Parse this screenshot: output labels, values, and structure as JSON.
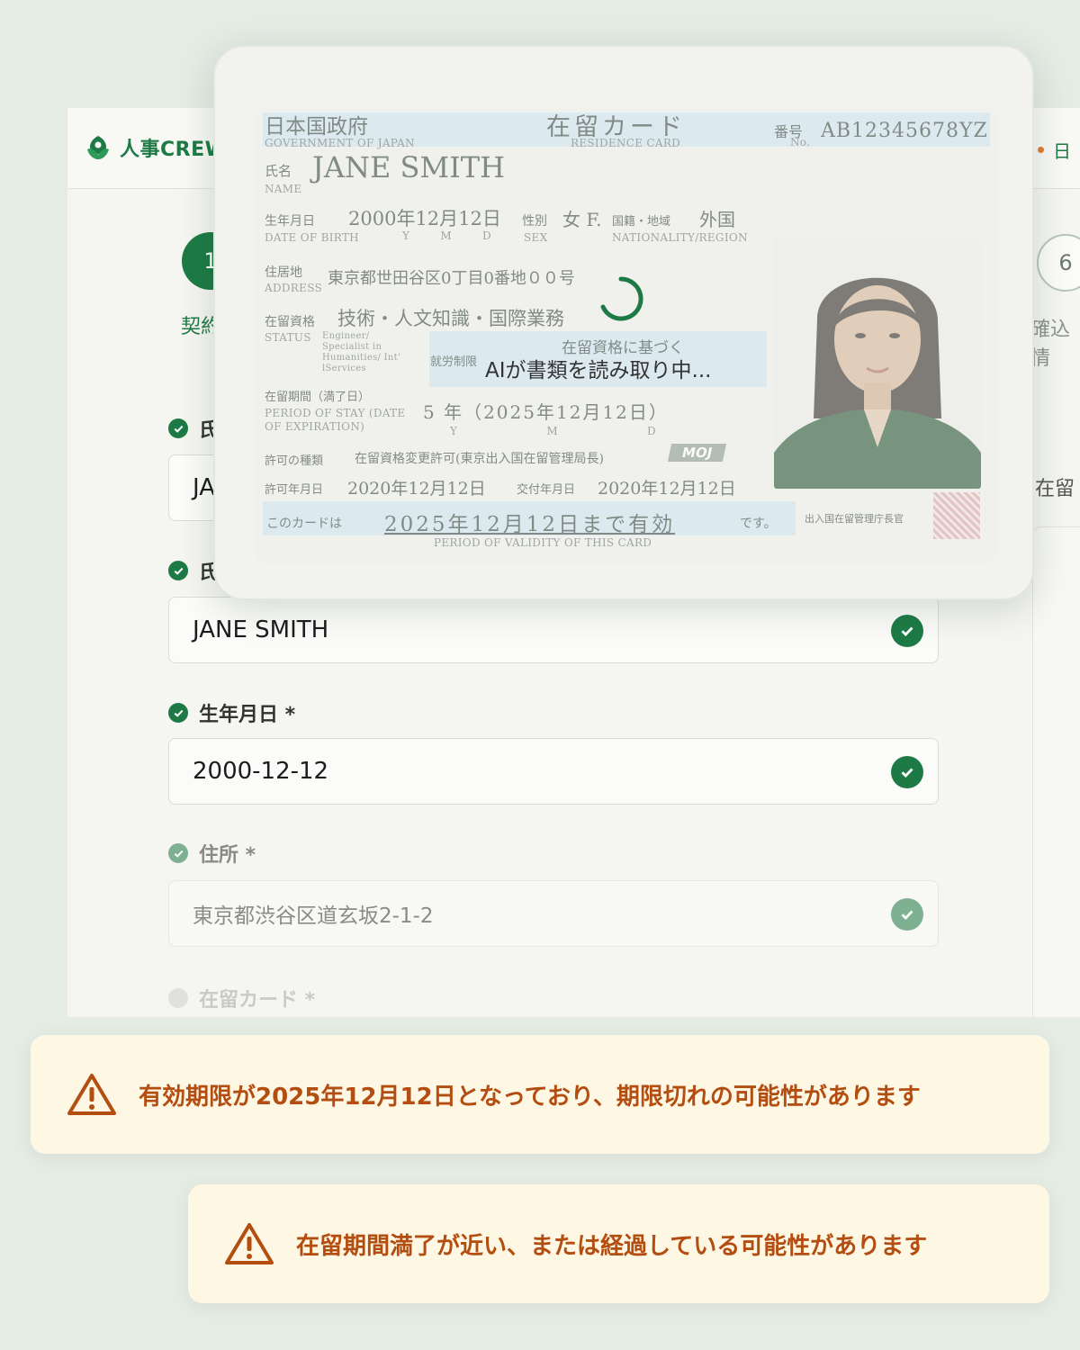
{
  "app": {
    "logo_text": "人事CREW",
    "language": "日",
    "steps": {
      "first": {
        "number": "1",
        "label": "契約"
      },
      "last": {
        "number": "6",
        "label": "確込情"
      }
    },
    "side_label": "在留",
    "fields": [
      {
        "label": "氏",
        "value": "JA"
      },
      {
        "label": "氏",
        "value": "JANE SMITH"
      },
      {
        "label": "生年月日 *",
        "value": "2000-12-12"
      },
      {
        "label": "住所 *",
        "value": "東京都渋谷区道玄坂2-1-2"
      },
      {
        "label": "在留カード *"
      }
    ]
  },
  "card": {
    "gov": "日本国政府",
    "gov_en": "GOVERNMENT OF JAPAN",
    "title": "在留カード",
    "title_en": "RESIDENCE CARD",
    "number_label": "番号",
    "number_label_en": "No.",
    "number": "AB12345678YZ",
    "name_label": "氏名",
    "name_label_en": "NAME",
    "name": "JANE SMITH",
    "dob_label": "生年月日",
    "dob_label_en": "DATE OF BIRTH",
    "dob": "2000年12月12日",
    "ymd": "Y M D",
    "sex_label": "性別",
    "sex_label_en": "SEX",
    "sex": "女 F.",
    "nat_label": "国籍・地域",
    "nat_label_en": "NATIONALITY/REGION",
    "nationality": "外国",
    "addr_label": "住居地",
    "addr_label_en": "ADDRESS",
    "address": "東京都世田谷区0丁目0番地００号",
    "status_label": "在留資格",
    "status_label_en": "STATUS",
    "status": "技術・人文知識・国際業務",
    "status_en": "Engineer/ Specialist in Humanities/ Int' lServices",
    "work_label": "就労制限",
    "work": "在留資格に基づく",
    "period_label": "在留期間（満了日）",
    "period_label_en": "PERIOD OF STAY (DATE OF EXPIRATION)",
    "period": "5 年（2025年12月12日）",
    "permit_type_label": "許可の種類",
    "permit_type": "在留資格変更許可(東京出入国在留管理局長)",
    "moj": "MOJ",
    "permit_date_label": "許可年月日",
    "permit_date": "2020年12月12日",
    "issue_date_label": "交付年月日",
    "issue_date": "2020年12月12日",
    "validity_prefix": "このカードは",
    "validity": "2025年12月12日まで有効",
    "validity_suffix": "です。",
    "validity_en": "PERIOD OF VALIDITY OF THIS CARD",
    "issuer": "出入国在留管理庁長官"
  },
  "loading_text": "AIが書類を読み取り中...",
  "warnings": [
    "有効期限が2025年12月12日となっており、期限切れの可能性があります",
    "在留期間満了が近い、または経過している可能性があります"
  ],
  "colors": {
    "brand": "#1d7a45",
    "warning_text": "#b34d10",
    "warning_bg": "#fdf7e4"
  }
}
